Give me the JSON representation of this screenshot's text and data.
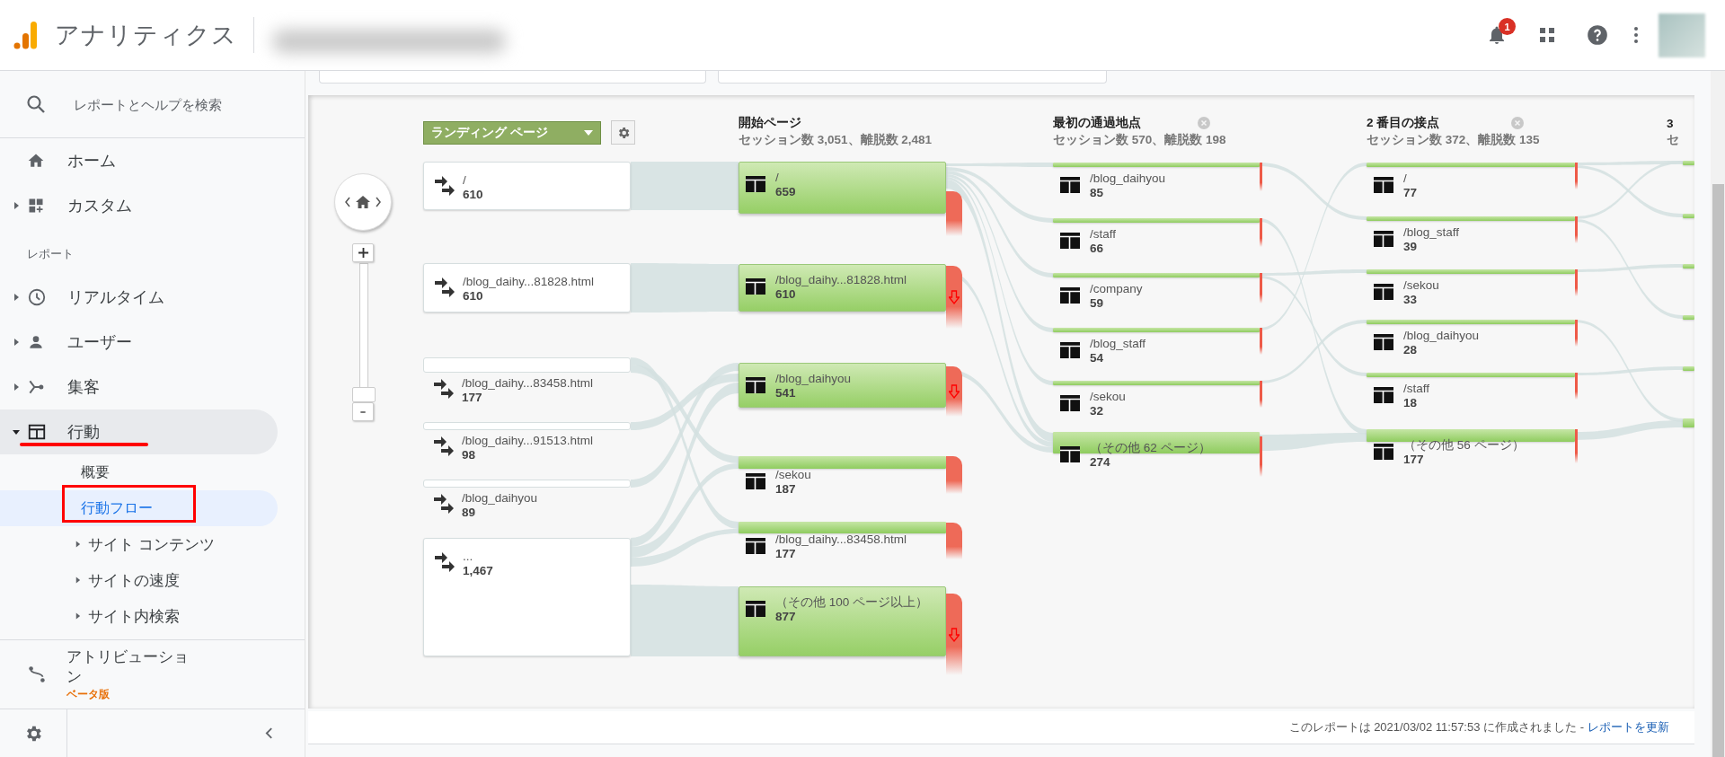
{
  "header": {
    "product": "アナリティクス",
    "notification_count": "1"
  },
  "sidebar": {
    "search_placeholder": "レポートとヘルプを検索",
    "items": [
      {
        "kind": "link",
        "label": "ホーム",
        "selected": false
      },
      {
        "kind": "group",
        "label": "カスタム",
        "expanded": false,
        "selected": false
      },
      {
        "kind": "heading",
        "label": "レポート"
      },
      {
        "kind": "group",
        "label": "リアルタイム",
        "expanded": false,
        "selected": false
      },
      {
        "kind": "group",
        "label": "ユーザー",
        "expanded": false,
        "selected": false
      },
      {
        "kind": "group",
        "label": "集客",
        "expanded": false,
        "selected": false
      },
      {
        "kind": "group",
        "label": "行動",
        "expanded": true,
        "selected": true,
        "children": [
          {
            "kind": "link",
            "label": "概要",
            "selected": false
          },
          {
            "kind": "link",
            "label": "行動フロー",
            "selected": true
          },
          {
            "kind": "group",
            "label": "サイト コンテンツ",
            "expanded": false,
            "selected": false
          },
          {
            "kind": "group",
            "label": "サイトの速度",
            "expanded": false,
            "selected": false
          },
          {
            "kind": "group",
            "label": "サイト内検索",
            "expanded": false,
            "selected": false
          }
        ]
      }
    ],
    "attribution": {
      "label": "アトリビューション",
      "badge": "ベータ版"
    }
  },
  "flow": {
    "dimension": "ランディング ページ",
    "zoom": {
      "level": 0
    },
    "landing_pages": [
      {
        "kind": "box",
        "label": "/",
        "count": "610"
      },
      {
        "kind": "box",
        "label": "/blog_daihy...81828.html",
        "count": "610"
      },
      {
        "kind": "bar",
        "label": "/blog_daihy...83458.html",
        "count": "177"
      },
      {
        "kind": "bar",
        "label": "/blog_daihy...91513.html",
        "count": "98"
      },
      {
        "kind": "bar",
        "label": "/blog_daihyou",
        "count": "89"
      },
      {
        "kind": "box",
        "label": "...",
        "count": "1,467"
      }
    ],
    "columns": [
      {
        "kind": "start",
        "title": "開始ページ",
        "summary": "セッション数 3,051、離脱数 2,481",
        "pages": [
          {
            "kind": "block",
            "label": "/",
            "count": "659",
            "exit_marker": false
          },
          {
            "kind": "block",
            "label": "/blog_daihy...81828.html",
            "count": "610",
            "exit_marker": true
          },
          {
            "kind": "block",
            "label": "/blog_daihyou",
            "count": "541",
            "exit_marker": true
          },
          {
            "kind": "bar",
            "label": "/sekou",
            "count": "187",
            "exit_marker": false
          },
          {
            "kind": "bar",
            "label": "/blog_daihy...83458.html",
            "count": "177",
            "exit_marker": false
          },
          {
            "kind": "block",
            "label": "（その他 100 ページ以上）",
            "count": "877",
            "exit_marker": true
          }
        ]
      },
      {
        "kind": "step",
        "title": "最初の通過地点",
        "summary": "セッション数 570、離脱数 198",
        "pages": [
          {
            "kind": "bar",
            "label": "/blog_daihyou",
            "count": "85",
            "exit_marker": false
          },
          {
            "kind": "bar",
            "label": "/staff",
            "count": "66",
            "exit_marker": false
          },
          {
            "kind": "bar",
            "label": "/company",
            "count": "59",
            "exit_marker": false
          },
          {
            "kind": "bar",
            "label": "/blog_staff",
            "count": "54",
            "exit_marker": false
          },
          {
            "kind": "bar",
            "label": "/sekou",
            "count": "32",
            "exit_marker": false
          },
          {
            "kind": "bar",
            "label": "（その他 62 ページ）",
            "count": "274",
            "exit_marker": false
          }
        ]
      },
      {
        "kind": "step",
        "title": "2 番目の接点",
        "summary": "セッション数 372、離脱数 135",
        "pages": [
          {
            "kind": "bar",
            "label": "/",
            "count": "77",
            "exit_marker": false
          },
          {
            "kind": "bar",
            "label": "/blog_staff",
            "count": "39",
            "exit_marker": false
          },
          {
            "kind": "bar",
            "label": "/sekou",
            "count": "33",
            "exit_marker": false
          },
          {
            "kind": "bar",
            "label": "/blog_daihyou",
            "count": "28",
            "exit_marker": false
          },
          {
            "kind": "bar",
            "label": "/staff",
            "count": "18",
            "exit_marker": false
          },
          {
            "kind": "bar",
            "label": "（その他 56 ページ）",
            "count": "177",
            "exit_marker": false
          }
        ]
      },
      {
        "kind": "step",
        "title": "3",
        "summary": "セ",
        "pages": [
          {
            "kind": "stub"
          },
          {
            "kind": "stub"
          },
          {
            "kind": "stub"
          },
          {
            "kind": "stub"
          },
          {
            "kind": "stub"
          },
          {
            "kind": "stub"
          }
        ]
      }
    ]
  },
  "footer": {
    "generated": "このレポートは 2021/03/02 11:57:53 に作成されました -",
    "refresh_link": "レポートを更新"
  }
}
